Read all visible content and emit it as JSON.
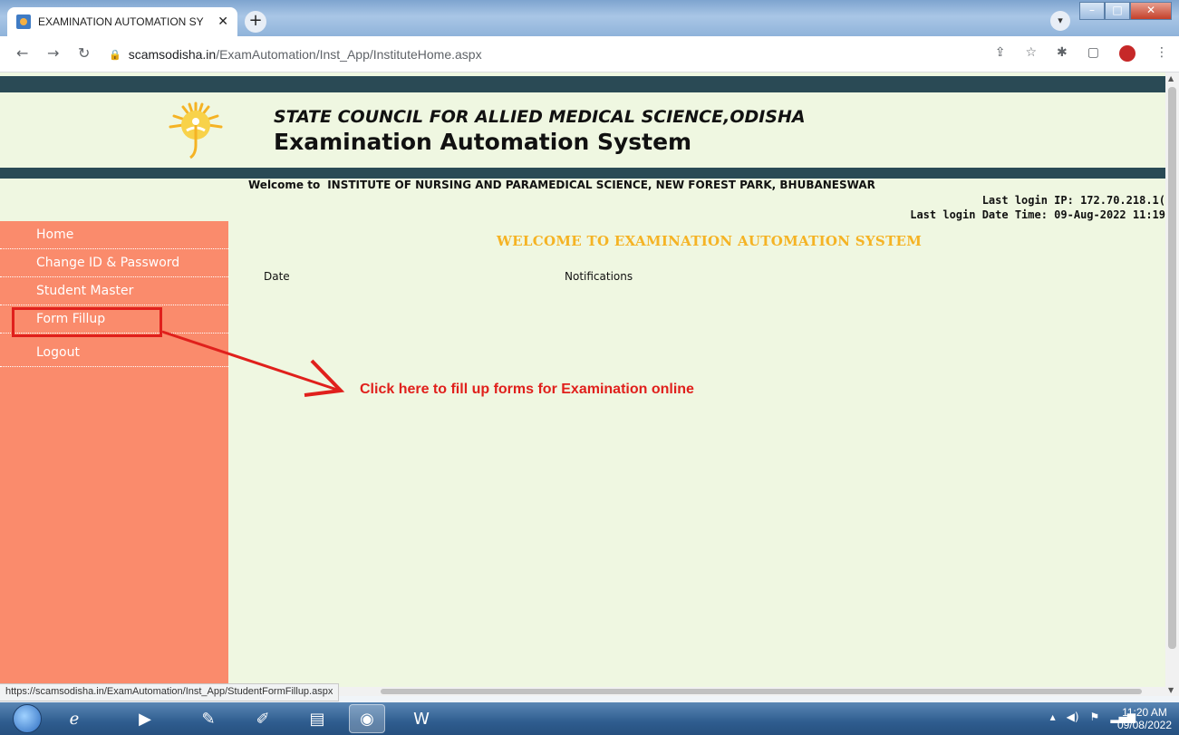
{
  "browser": {
    "tab_title": "EXAMINATION AUTOMATION SY",
    "tab_close": "✕",
    "new_tab": "+",
    "url_host": "scamsodisha.in",
    "url_path": "/ExamAutomation/Inst_App/InstituteHome.aspx",
    "status_url": "https://scamsodisha.in/ExamAutomation/Inst_App/StudentFormFillup.aspx"
  },
  "header": {
    "council_name": "STATE COUNCIL FOR ALLIED MEDICAL SCIENCE,ODISHA",
    "system_name": "Examination Automation System"
  },
  "welcome": {
    "prefix": "Welcome to",
    "institute": "INSTITUTE OF NURSING AND PARAMEDICAL SCIENCE, NEW FOREST PARK, BHUBANESWAR",
    "last_login_ip": "Last login IP: 172.70.218.1(",
    "last_login_time": "Last login Date Time: 09-Aug-2022 11:19"
  },
  "sidebar": {
    "items": [
      {
        "label": "Home"
      },
      {
        "label": "Change ID & Password"
      },
      {
        "label": "Student Master"
      },
      {
        "label": "Form Fillup"
      },
      {
        "label": "Logout"
      }
    ]
  },
  "main": {
    "title": "WELCOME TO EXAMINATION AUTOMATION SYSTEM",
    "col_date": "Date",
    "col_notifications": "Notifications"
  },
  "annotation": {
    "text": "Click here to fill up forms for Examination online",
    "color": "#e0201c"
  },
  "taskbar": {
    "time": "11:20 AM",
    "date": "09/08/2022"
  },
  "colors": {
    "sidebar": "#fa8b6c",
    "page_bg": "#eff7e1",
    "band": "#2a4a55",
    "title_accent": "#f5b324"
  }
}
